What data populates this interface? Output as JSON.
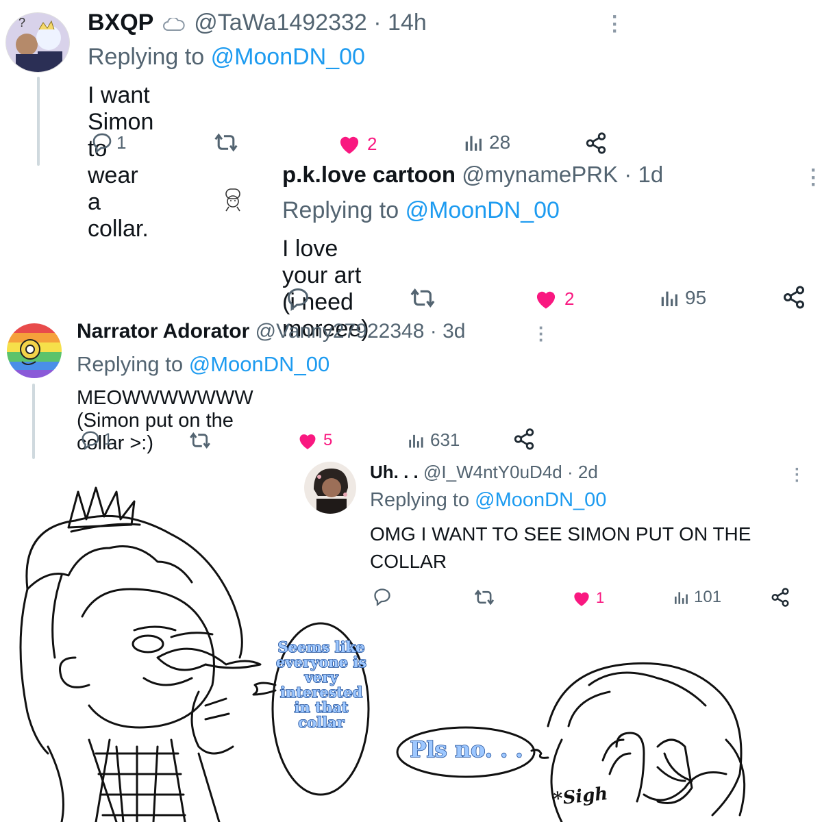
{
  "tweets": [
    {
      "name": "BXQP",
      "name_suffix_icon": "cloud-icon",
      "handle": "@TaWa1492332",
      "time": "14h",
      "replying_prefix": "Replying to",
      "replying_to": "@MoonDN_00",
      "text": "I want Simon to wear a collar.",
      "replies": "1",
      "retweets": "",
      "likes": "2",
      "views": "28"
    },
    {
      "name": "p.k.love cartoon",
      "handle": "@mynamePRK",
      "time": "1d",
      "replying_prefix": "Replying to",
      "replying_to": "@MoonDN_00",
      "text": "I love your art (i need moreee)",
      "replies": "",
      "retweets": "",
      "likes": "2",
      "views": "95"
    },
    {
      "name": "Narrator Adorator",
      "handle": "@Vanny27922348",
      "time": "3d",
      "replying_prefix": "Replying to",
      "replying_to": "@MoonDN_00",
      "text": "MEOWWWWWWW (Simon put on the collar >:)",
      "replies": "1",
      "retweets": "",
      "likes": "5",
      "views": "631"
    },
    {
      "name": "Uh. . .",
      "handle": "@I_W4ntY0uD4d",
      "time": "2d",
      "replying_prefix": "Replying to",
      "replying_to": "@MoonDN_00",
      "text": "OMG I WANT TO SEE SIMON PUT ON THE COLLAR",
      "replies": "",
      "retweets": "",
      "likes": "1",
      "views": "101"
    }
  ],
  "comic": {
    "bubble_left": [
      "Seems like",
      "everyone is",
      "very",
      "interested",
      "in that",
      "collar"
    ],
    "bubble_right": "Pls no. . .",
    "sfx": "*Sigh"
  },
  "colors": {
    "like": "#f91880",
    "link": "#1d9bf0",
    "muted": "#536471",
    "comic_text_fill": "#9ec8ff",
    "comic_text_outline": "#1f4e99"
  }
}
